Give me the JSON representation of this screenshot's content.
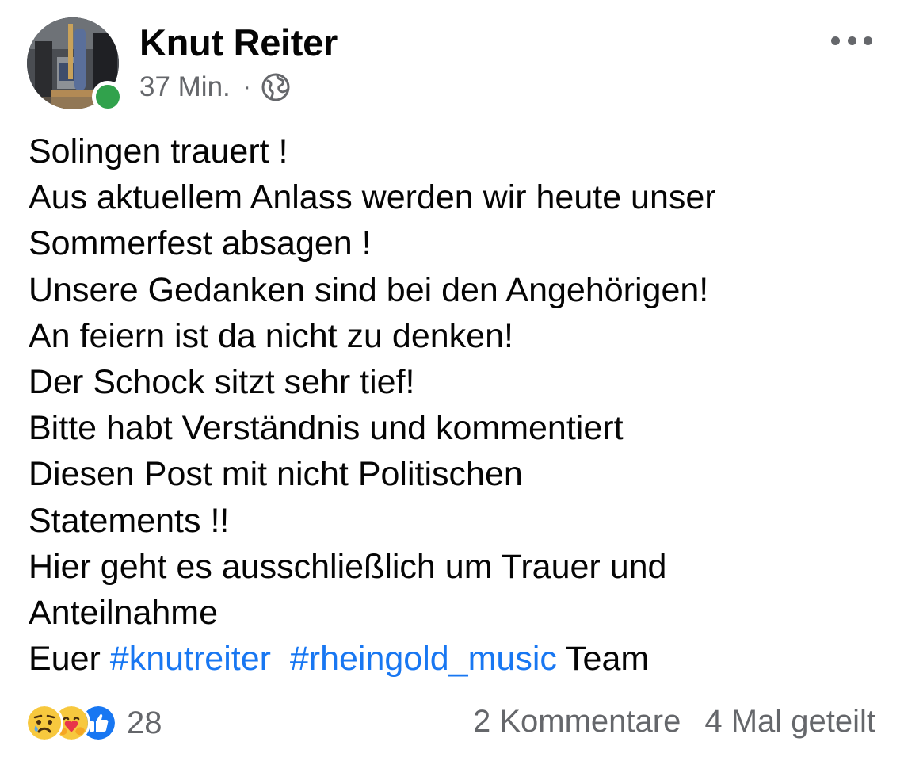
{
  "post": {
    "author_name": "Knut Reiter",
    "timestamp": "37 Min.",
    "separator": "·",
    "audience_icon": "globe-icon",
    "more_icon": "more-options-icon",
    "online_status_color": "#31a24c",
    "text_lines": [
      "Solingen trauert !",
      "Aus aktuellem Anlass werden wir heute unser",
      "Sommerfest absagen !",
      "Unsere Gedanken sind bei den Angehörigen!",
      "An feiern ist da nicht zu denken!",
      "Der Schock sitzt sehr tief!",
      "Bitte habt Verständnis und kommentiert",
      "Diesen Post mit nicht Politischen",
      "Statements !!",
      "Hier geht es ausschließlich um Trauer und",
      "Anteilnahme"
    ],
    "last_line": {
      "prefix": "Euer ",
      "hashtag_1": "#knutreiter",
      "hashtag_2": "#rheingold_music",
      "suffix": " Team"
    },
    "hashtag_color": "#1877f2"
  },
  "footer": {
    "reaction_icons": [
      "sad-reaction-icon",
      "care-reaction-icon",
      "like-reaction-icon"
    ],
    "reaction_count": "28",
    "comments": "2 Kommentare",
    "shares": "4 Mal geteilt"
  }
}
